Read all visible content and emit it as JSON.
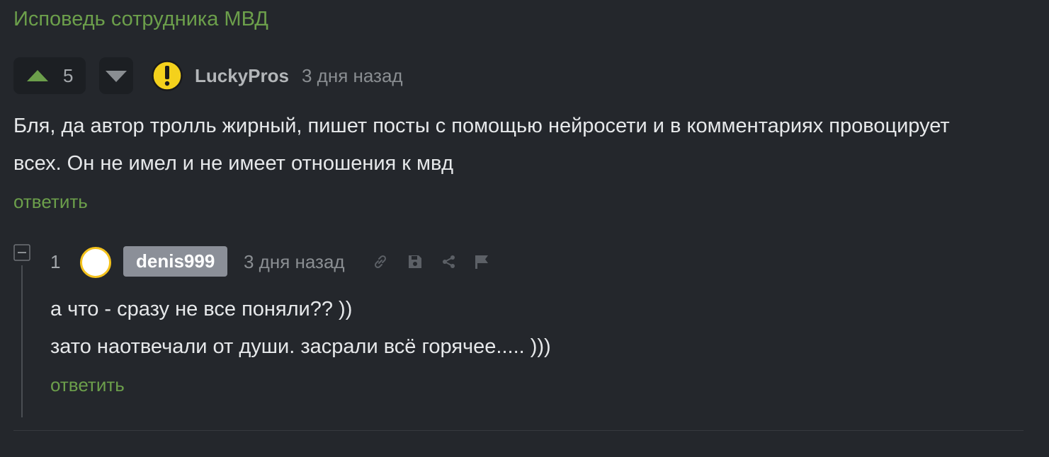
{
  "post": {
    "title": "Исповедь сотрудника МВД"
  },
  "comment": {
    "votes": "5",
    "author": "LuckyPros",
    "time": "3 дня назад",
    "text_line1": "Бля, да автор тролль жирный, пишет посты с помощью нейросети и в комментариях провоцирует",
    "text_line2": "всех. Он не имел и не имеет отношения к мвд",
    "reply_label": "ответить"
  },
  "reply": {
    "rating": "1",
    "author": "denis999",
    "time": "3 дня назад",
    "text_line1": "а что - сразу не все поняли?? ))",
    "text_line2": "зато наотвечали от души. засрали всё горячее..... )))",
    "reply_label": "ответить"
  },
  "colors": {
    "accent": "#6c9f4b",
    "background": "#24272c",
    "warning": "#f4d11c"
  },
  "icons": [
    "arrow-up-icon",
    "arrow-down-icon",
    "warning-icon",
    "collapse-icon",
    "link-icon",
    "save-icon",
    "share-icon",
    "flag-icon"
  ]
}
